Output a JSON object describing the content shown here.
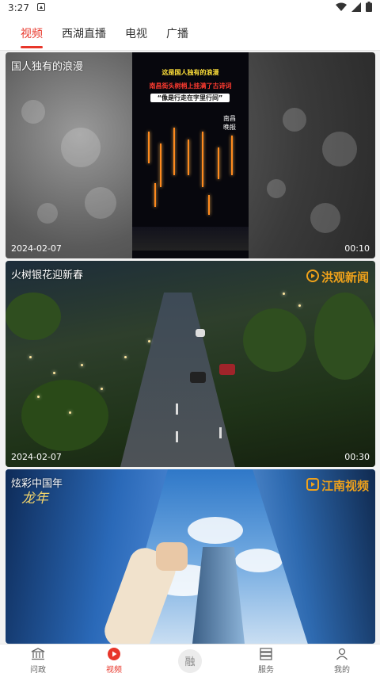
{
  "status_bar": {
    "time": "3:27"
  },
  "tabs": [
    {
      "label": "视频"
    },
    {
      "label": "西湖直播"
    },
    {
      "label": "电视"
    },
    {
      "label": "广播"
    }
  ],
  "feed": [
    {
      "title": "国人独有的浪漫",
      "date": "2024-02-07",
      "duration": "00:10",
      "poster_lines": [
        "这是国人独有的浪漫",
        "南昌街头树梢上挂满了古诗词",
        "“像是行走在字里行间”"
      ],
      "poster_side": "南昌晚报"
    },
    {
      "title": "火树银花迎新春",
      "date": "2024-02-07",
      "duration": "00:30",
      "logo": "洪观新闻"
    },
    {
      "title": "炫彩中国年",
      "logo": "江南视频",
      "brush_text": "龙年"
    }
  ],
  "bottom_nav": [
    {
      "label": "问政",
      "icon": "building-icon"
    },
    {
      "label": "视频",
      "icon": "play-icon"
    },
    {
      "label": "融",
      "icon": "center-icon"
    },
    {
      "label": "服务",
      "icon": "list-icon"
    },
    {
      "label": "我的",
      "icon": "user-icon"
    }
  ],
  "colors": {
    "accent": "#e8362a",
    "logo_orange": "#f0a21a"
  }
}
